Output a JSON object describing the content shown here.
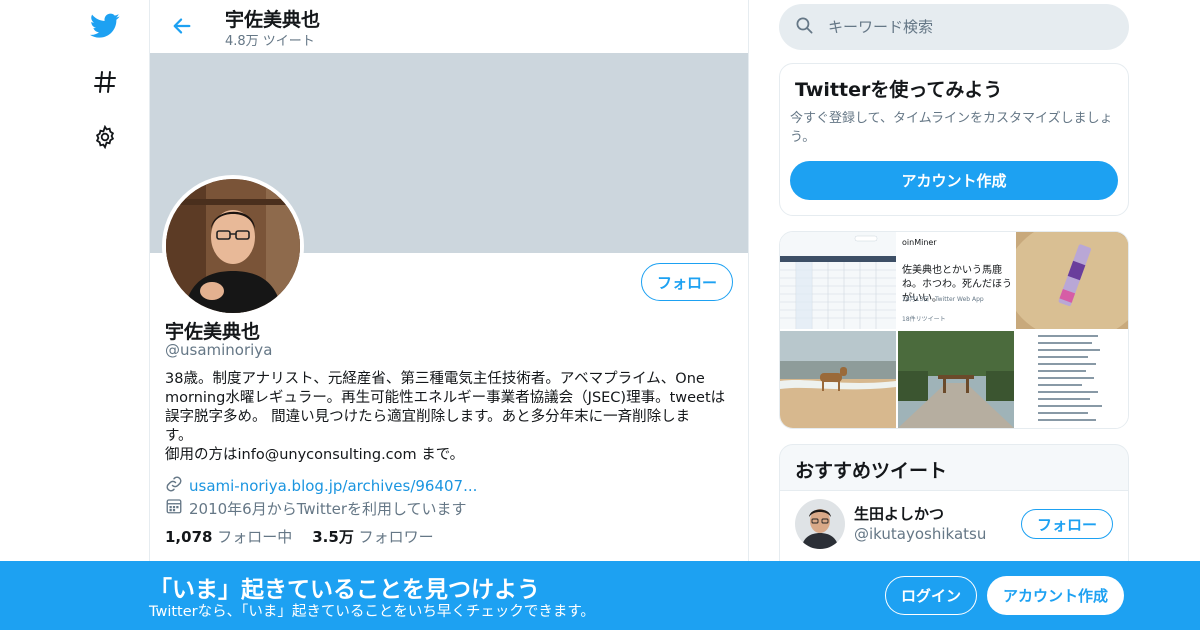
{
  "nav": {
    "icons": [
      "twitter-bird-icon",
      "hashtag-icon",
      "gear-icon"
    ]
  },
  "header": {
    "title": "宇佐美典也",
    "tweet_count": "4.8万 ツイート"
  },
  "profile": {
    "name": "宇佐美典也",
    "handle": "@usaminoriya",
    "follow_label": "フォロー",
    "bio": "38歳。制度アナリスト、元経産省、第三種電気主任技術者。アベマプライム、One\nmorning水曜レギュラー。再生可能性エネルギー事業者協議会（JSEC)理事。tweetは\n誤字脱字多め。 間違い見つけたら適宜削除します。あと多分年末に一斉削除しま\nす。\n御用の方はinfo@unyconsulting.com まで。",
    "link": "usami-noriya.blog.jp/archives/96407...",
    "joined": "2010年6月からTwitterを利用しています",
    "following_count": "1,078",
    "following_label": "フォロー中",
    "followers_count": "3.5万",
    "followers_label": "フォロワー"
  },
  "search": {
    "placeholder": "キーワード検索"
  },
  "signup_card": {
    "title": "Twitterを使ってみよう",
    "description": "今すぐ登録して、タイムラインをカスタマイズしましょう。",
    "button": "アカウント作成"
  },
  "media_card": {
    "tweet_preview": {
      "source": "oinMiner",
      "text": "佐美典也とかいう馬鹿ね。ホつわ。死んだほうがいい。",
      "meta": "18月13日 · Twitter Web App",
      "retweets": "18件リツイート"
    }
  },
  "recommended": {
    "title": "おすすめツイート",
    "users": [
      {
        "name": "生田よしかつ",
        "handle": "@ikutayoshikatsu",
        "follow_label": "フォロー"
      }
    ]
  },
  "bottom_bar": {
    "title": "「いま」起きていることを見つけよう",
    "subtitle": "Twitterなら、「いま」起きていることをいち早くチェックできます。",
    "login": "ログイン",
    "signup": "アカウント作成"
  },
  "colors": {
    "accent": "#1da1f2",
    "banner": "#ccd6dd",
    "muted_text": "#657786"
  }
}
